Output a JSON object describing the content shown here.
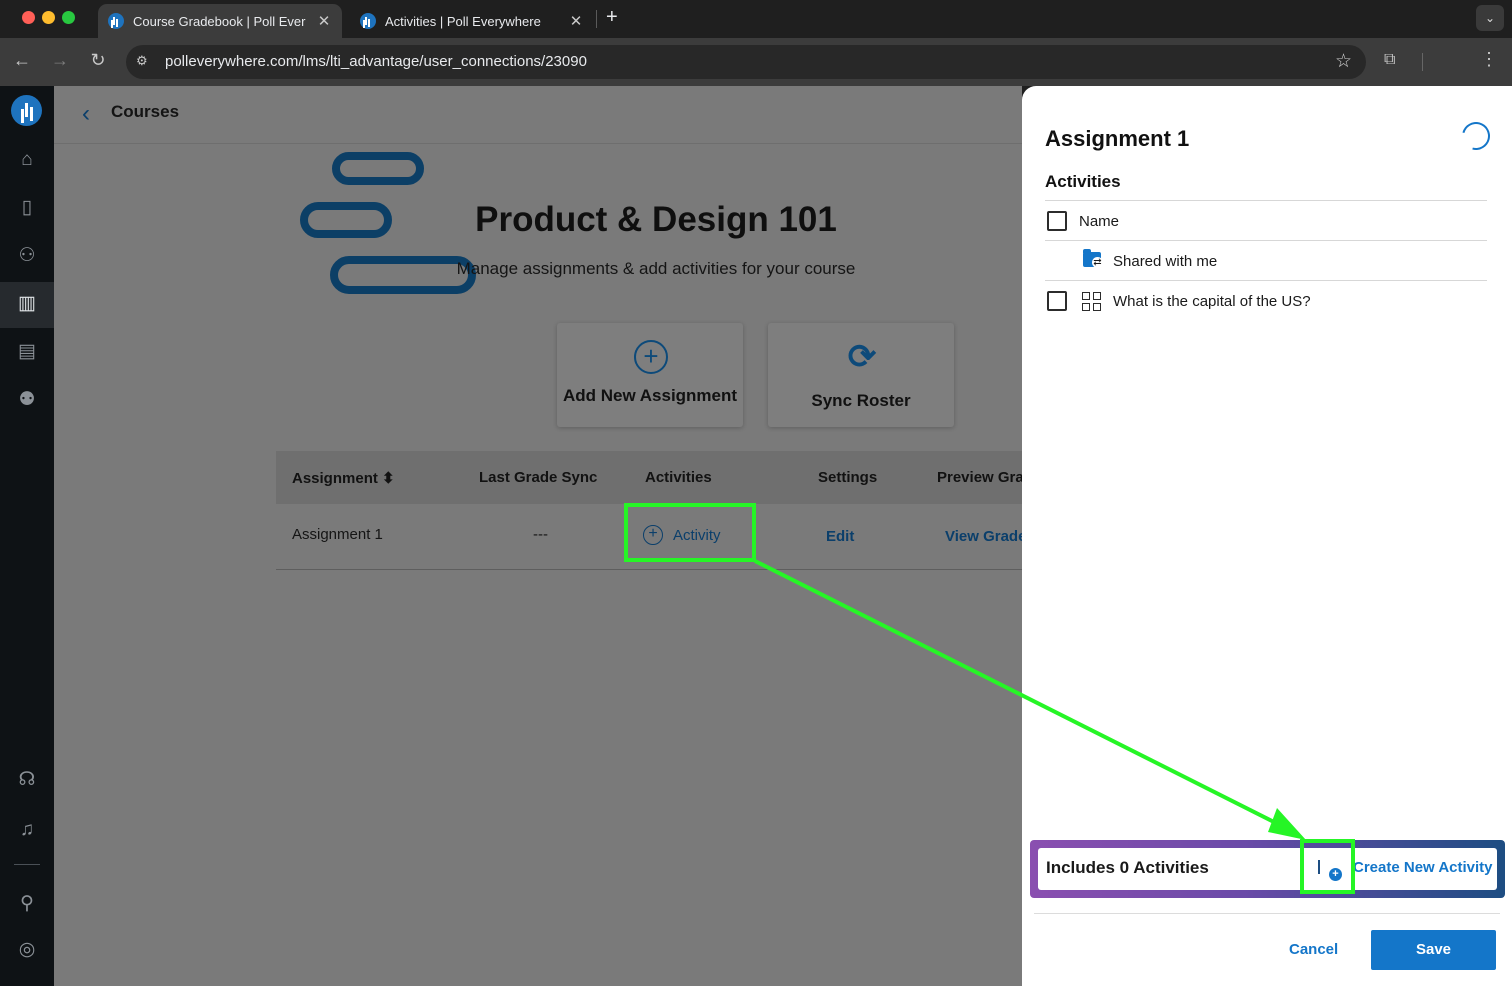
{
  "browser": {
    "tabs": [
      {
        "title": "Course Gradebook | Poll Ever",
        "active": true
      },
      {
        "title": "Activities | Poll Everywhere",
        "active": false
      }
    ],
    "url": "polleverywhere.com/lms/lti_advantage/user_connections/23090"
  },
  "sidebar": {
    "items": [
      "home-icon",
      "results-icon",
      "participants-icon",
      "courses-icon",
      "reports-icon",
      "groups-icon",
      "support-icon",
      "notifications-icon",
      "add-user-icon",
      "profile-icon"
    ],
    "active": "courses-icon"
  },
  "main": {
    "breadcrumb": "Courses",
    "course_title": "Product & Design 101",
    "course_subtitle": "Manage assignments & add activities for your course",
    "actions": {
      "add_assignment": "Add New Assignment",
      "sync_roster": "Sync Roster"
    },
    "table": {
      "headers": {
        "assignment": "Assignment",
        "last_sync": "Last Grade Sync",
        "activities": "Activities",
        "settings": "Settings",
        "preview": "Preview Grac"
      },
      "row": {
        "assignment": "Assignment 1",
        "last_sync": "---",
        "activity": "Activity",
        "edit": "Edit",
        "view_grades": "View Grade"
      }
    }
  },
  "drawer": {
    "title": "Assignment 1",
    "section": "Activities",
    "name_header": "Name",
    "folder": "Shared with me",
    "activity_item": "What is the capital of the US?",
    "includes": "Includes 0 Activities",
    "create_label": "Create New Activity",
    "cancel": "Cancel",
    "save": "Save"
  },
  "colors": {
    "accent": "#1476c9",
    "highlight": "#26f526",
    "navy": "#0c3f66"
  }
}
